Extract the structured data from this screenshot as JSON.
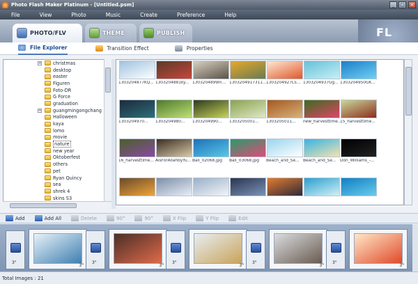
{
  "window": {
    "title": "Photo Flash Maker Platinum - [Untitled.psm]"
  },
  "menu": [
    "File",
    "View",
    "Photo",
    "Music",
    "Create",
    "Preference",
    "Help"
  ],
  "tabs": [
    {
      "label": "Photo/FLV",
      "active": true
    },
    {
      "label": "Theme",
      "active": false
    },
    {
      "label": "Publish",
      "active": false
    }
  ],
  "logo_text": "FL",
  "subtabs": [
    "File Explorer",
    "Transition Effect",
    "Properties"
  ],
  "folders": [
    {
      "name": "christmas",
      "expandable": true
    },
    {
      "name": "desktop",
      "expandable": false
    },
    {
      "name": "easter",
      "expandable": false
    },
    {
      "name": "Figuren",
      "expandable": false
    },
    {
      "name": "Foto-DR",
      "expandable": false
    },
    {
      "name": "G Force",
      "expandable": false
    },
    {
      "name": "graduation",
      "expandable": false
    },
    {
      "name": "guangmingongchang",
      "expandable": true
    },
    {
      "name": "Halloween",
      "expandable": false
    },
    {
      "name": "kaya",
      "expandable": false
    },
    {
      "name": "lomo",
      "expandable": false
    },
    {
      "name": "movie",
      "expandable": false
    },
    {
      "name": "nature",
      "expandable": false
    },
    {
      "name": "new year",
      "expandable": false
    },
    {
      "name": "Oktoberfest",
      "expandable": false
    },
    {
      "name": "others",
      "expandable": false
    },
    {
      "name": "pet",
      "expandable": false
    },
    {
      "name": "Ryan Quincy",
      "expandable": false
    },
    {
      "name": "sea",
      "expandable": false
    },
    {
      "name": "shrek 4",
      "expandable": false
    },
    {
      "name": "skins S3",
      "expandable": false
    }
  ],
  "thumbnails": [
    {
      "caption": "1303204877KQ...",
      "c1": "#9fc3e0",
      "c2": "#ffffff"
    },
    {
      "caption": "1303204881ky...",
      "c1": "#5a3a2a",
      "c2": "#c8463b"
    },
    {
      "caption": "1303204899m...",
      "c1": "#d7d0c0",
      "c2": "#5a5247"
    },
    {
      "caption": "1303204917311...",
      "c1": "#e6a82e",
      "c2": "#6a7b4f"
    },
    {
      "caption": "1303204927L5...",
      "c1": "#fde8d3",
      "c2": "#e0582a"
    },
    {
      "caption": "1303204937Gg...",
      "c1": "#63c2d9",
      "c2": "#c9eef5"
    },
    {
      "caption": "1303204950GK...",
      "c1": "#1c7fc7",
      "c2": "#6fd0f3"
    },
    {
      "caption": "1303204970...",
      "c1": "#1d2a3b",
      "c2": "#2e6e7a"
    },
    {
      "caption": "1303204980...",
      "c1": "#4f7a2a",
      "c2": "#bfe07a"
    },
    {
      "caption": "1303204990...",
      "c1": "#2e3a1e",
      "c2": "#c8d35a"
    },
    {
      "caption": "1303205001...",
      "c1": "#8aa24c",
      "c2": "#dfe8c8"
    },
    {
      "caption": "1303205011...",
      "c1": "#a5581f",
      "c2": "#d7b27c"
    },
    {
      "caption": "new_harvesttime...",
      "c1": "#3f6b1f",
      "c2": "#e0446a"
    },
    {
      "caption": "15_harvesttime...",
      "c1": "#c9d79a",
      "c2": "#8b2d1d"
    },
    {
      "caption": "16_harvesttime...",
      "c1": "#4a5f2c",
      "c2": "#8a4aa2"
    },
    {
      "caption": "AisForAllahbyYu...",
      "c1": "#3b2e22",
      "c2": "#d8c9a8"
    },
    {
      "caption": "Bali_02068.jpg",
      "c1": "#1e72b8",
      "c2": "#58c7e6"
    },
    {
      "caption": "Bali_03068.jpg",
      "c1": "#2a9a6a",
      "c2": "#e24a7a"
    },
    {
      "caption": "Beach_and_Se...",
      "c1": "#9ad4ee",
      "c2": "#ffffff"
    },
    {
      "caption": "Beach_and_Se...",
      "c1": "#36b4e3",
      "c2": "#f3e2b0"
    },
    {
      "caption": "Don_Williams_-...",
      "c1": "#000000",
      "c2": "#222222"
    },
    {
      "caption": "",
      "c1": "#6a4a2a",
      "c2": "#f0a53a"
    },
    {
      "caption": "",
      "c1": "#7d8fa8",
      "c2": "#e8eef6"
    },
    {
      "caption": "",
      "c1": "#9ab0c8",
      "c2": "#f2f4f7"
    },
    {
      "caption": "",
      "c1": "#2a3550",
      "c2": "#7c93b8"
    },
    {
      "caption": "",
      "c1": "#e37b2e",
      "c2": "#2c2a3a"
    },
    {
      "caption": "",
      "c1": "#2aa0d0",
      "c2": "#d2f0f5"
    },
    {
      "caption": "",
      "c1": "#0f7fc4",
      "c2": "#6acbea"
    }
  ],
  "toolbar": [
    {
      "label": "Add",
      "enabled": true,
      "icon": "add-icon"
    },
    {
      "label": "Add All",
      "enabled": true,
      "icon": "add-all-icon"
    },
    {
      "label": "Delete",
      "enabled": false,
      "icon": "delete-icon"
    },
    {
      "label": "90°",
      "enabled": false,
      "icon": "rotate-left-icon"
    },
    {
      "label": "90°",
      "enabled": false,
      "icon": "rotate-right-icon"
    },
    {
      "label": "X Flip",
      "enabled": false,
      "icon": "x-flip-icon"
    },
    {
      "label": "Y Flip",
      "enabled": false,
      "icon": "y-flip-icon"
    },
    {
      "label": "Edit",
      "enabled": false,
      "icon": "edit-icon"
    }
  ],
  "timeline": [
    {
      "duration": "3\"",
      "c1": "#e8f2f8",
      "c2": "#3f7fb0"
    },
    {
      "duration": "3\"",
      "c1": "#4a2f28",
      "c2": "#e06a4a"
    },
    {
      "duration": "3\"",
      "c1": "#e7eef2",
      "c2": "#c9a35a"
    },
    {
      "duration": "3\"",
      "c1": "#d9dcdf",
      "c2": "#6a5b50"
    },
    {
      "duration": "3\"",
      "c1": "#ffe8c8",
      "c2": "#e04a2a"
    }
  ],
  "transition_duration": "3\"",
  "status": {
    "total": "Total Images : 21"
  }
}
